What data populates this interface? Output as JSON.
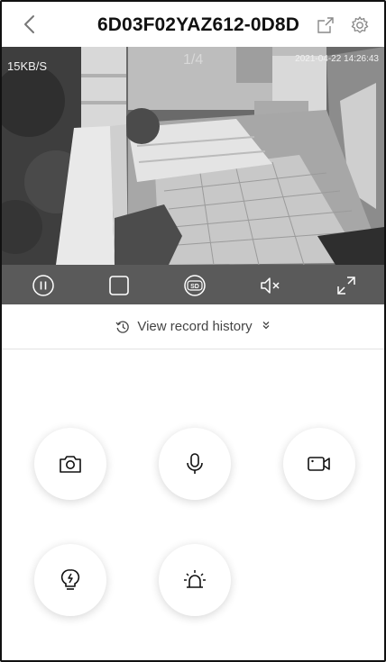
{
  "header": {
    "title": "6D03F02YAZ612-0D8D",
    "icons": [
      "chevron-left-icon",
      "share-icon",
      "gear-icon"
    ]
  },
  "video": {
    "speed": "15KB/S",
    "page_indicator": "1/4",
    "timestamp": "2021-04-22 14:26:43"
  },
  "controls": {
    "items": [
      "pause-icon",
      "stop-icon",
      "sd-icon",
      "mute-icon",
      "fullscreen-icon"
    ]
  },
  "history": {
    "label": "View record history",
    "chevron": "»"
  },
  "actions": {
    "items": [
      "camera-icon",
      "microphone-icon",
      "video-record-icon",
      "light-bulb-icon",
      "alarm-siren-icon"
    ]
  },
  "colors": {
    "video_bg": "#5a5a5a",
    "icon_stroke": "#111111"
  }
}
